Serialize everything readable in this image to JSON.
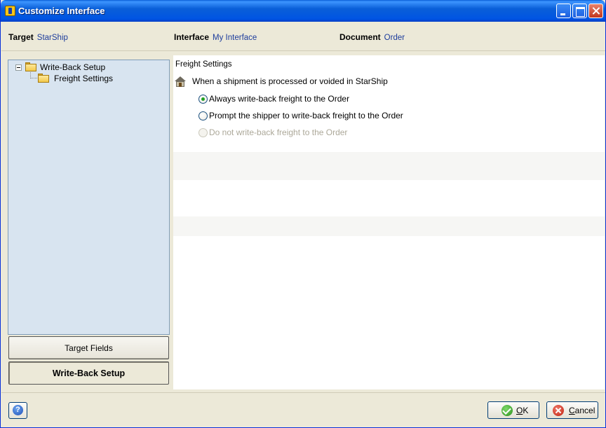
{
  "window": {
    "title": "Customize Interface"
  },
  "header": {
    "target_label": "Target",
    "target_value": "StarShip",
    "interface_label": "Interface",
    "interface_value": "My Interface",
    "document_label": "Document",
    "document_value": "Order"
  },
  "tree": {
    "root": "Write-Back Setup",
    "child": "Freight Settings"
  },
  "nav": {
    "target_fields": "Target Fields",
    "write_back_setup": "Write-Back Setup"
  },
  "content": {
    "section_title": "Freight Settings",
    "question": "When a shipment is processed or voided in StarShip",
    "options": [
      {
        "label": "Always write-back freight to the Order",
        "selected": true,
        "enabled": true
      },
      {
        "label": "Prompt the shipper to write-back freight to the Order",
        "selected": false,
        "enabled": true
      },
      {
        "label": "Do not write-back freight to the Order",
        "selected": false,
        "enabled": false
      }
    ]
  },
  "footer": {
    "help_glyph": "?",
    "ok_label_underlined": "O",
    "ok_label_rest": "K",
    "cancel_label_underlined": "C",
    "cancel_label_rest": "ancel"
  },
  "icons": {
    "window_icon": "app-icon",
    "tree_folder": "folder-icon",
    "setting_icon": "house-icon",
    "ok_icon": "check-icon",
    "cancel_icon": "cancel-x-icon",
    "help_icon": "help-icon"
  }
}
